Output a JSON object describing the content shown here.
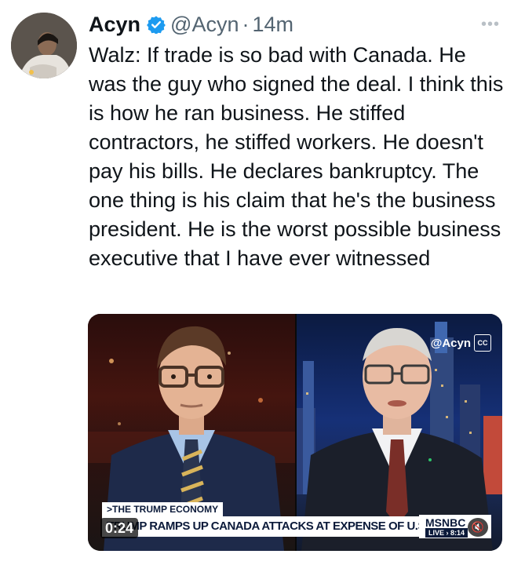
{
  "author": {
    "name": "Acyn",
    "handle": "@Acyn",
    "separator": "·",
    "time": "14m",
    "verified": true
  },
  "more_icon": "more-horizontal-icon",
  "text": "Walz: If trade is so bad with Canada. He was the guy who signed the deal. I think this is how he ran business. He stiffed contractors, he stiffed workers. He doesn't pay his bills. He declares bankruptcy. The one thing is his claim that he's the business president. He is the worst possible business executive that I have ever witnessed",
  "video": {
    "watermark": "@Acyn",
    "segment_tag": ">THE TRUMP ECONOMY",
    "headline": "TRUMP RAMPS UP CANADA ATTACKS AT EXPENSE OF U.S. ECONOMY",
    "network": "MSNBC",
    "live_label": "LIVE",
    "live_time": "8:14",
    "duration": "0:24"
  },
  "colors": {
    "text": "#0f1419",
    "secondary": "#536471",
    "verified_blue": "#1d9bf0"
  }
}
